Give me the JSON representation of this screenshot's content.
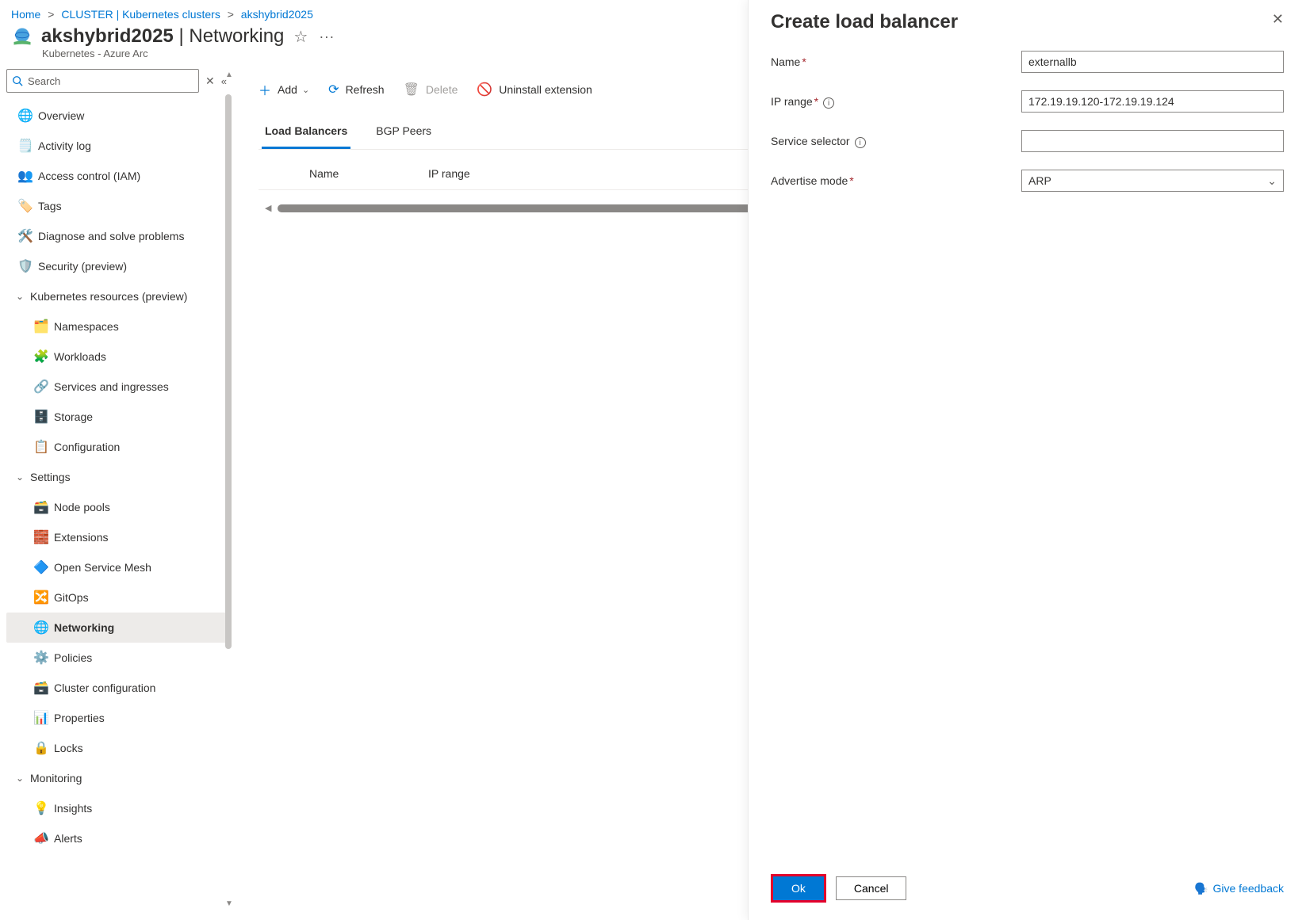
{
  "breadcrumb": {
    "home": "Home",
    "cluster": "CLUSTER | Kubernetes clusters",
    "current": "akshybrid2025"
  },
  "header": {
    "name": "akshybrid2025",
    "section": "Networking",
    "subtitle": "Kubernetes - Azure Arc"
  },
  "search": {
    "placeholder": "Search"
  },
  "nav": {
    "overview": "Overview",
    "activity": "Activity log",
    "iam": "Access control (IAM)",
    "tags": "Tags",
    "diagnose": "Diagnose and solve problems",
    "security": "Security (preview)",
    "g_k8s": "Kubernetes resources (preview)",
    "namespaces": "Namespaces",
    "workloads": "Workloads",
    "svc": "Services and ingresses",
    "storage": "Storage",
    "config": "Configuration",
    "g_set": "Settings",
    "nodepools": "Node pools",
    "ext": "Extensions",
    "osm": "Open Service Mesh",
    "gitops": "GitOps",
    "net": "Networking",
    "pol": "Policies",
    "cc": "Cluster configuration",
    "props": "Properties",
    "locks": "Locks",
    "g_mon": "Monitoring",
    "insights": "Insights",
    "alerts": "Alerts"
  },
  "toolbar": {
    "add": "Add",
    "refresh": "Refresh",
    "delete": "Delete",
    "uninstall": "Uninstall extension"
  },
  "tabs": {
    "lb": "Load Balancers",
    "bgp": "BGP Peers"
  },
  "table": {
    "name": "Name",
    "ip": "IP range"
  },
  "panel": {
    "title": "Create load balancer",
    "labels": {
      "name": "Name",
      "iprange": "IP range",
      "selector": "Service selector",
      "mode": "Advertise mode"
    },
    "values": {
      "name": "externallb",
      "iprange": "172.19.19.120-172.19.19.124",
      "selector": "",
      "mode": "ARP"
    },
    "buttons": {
      "ok": "Ok",
      "cancel": "Cancel"
    },
    "feedback": "Give feedback"
  }
}
